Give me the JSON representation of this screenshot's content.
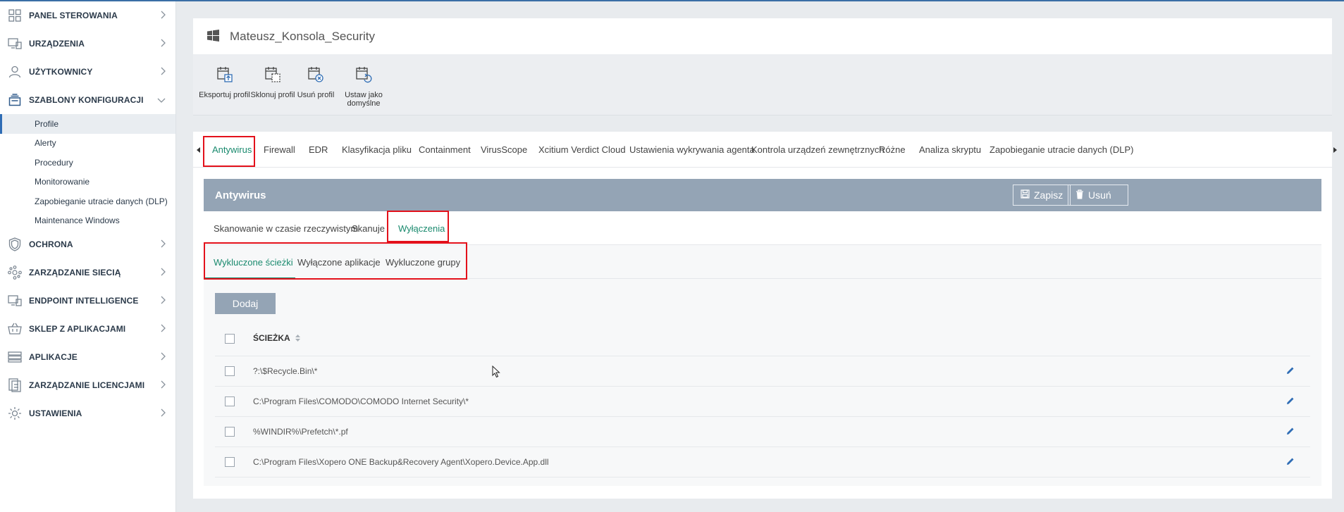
{
  "sidebar": {
    "items": [
      {
        "label": "PANEL STEROWANIA",
        "icon": "dashboard-icon"
      },
      {
        "label": "URZĄDZENIA",
        "icon": "devices-icon"
      },
      {
        "label": "UŻYTKOWNICY",
        "icon": "user-icon"
      },
      {
        "label": "SZABLONY KONFIGURACJI",
        "icon": "templates-icon"
      },
      {
        "label": "OCHRONA",
        "icon": "shield-icon"
      },
      {
        "label": "ZARZĄDZANIE SIECIĄ",
        "icon": "network-icon"
      },
      {
        "label": "ENDPOINT INTELLIGENCE",
        "icon": "endpoint-icon"
      },
      {
        "label": "SKLEP Z APLIKACJAMI",
        "icon": "basket-icon"
      },
      {
        "label": "APLIKACJE",
        "icon": "apps-icon"
      },
      {
        "label": "ZARZĄDZANIE LICENCJAMI",
        "icon": "license-icon"
      },
      {
        "label": "USTAWIENIA",
        "icon": "gear-icon"
      }
    ],
    "subitems": [
      "Profile",
      "Alerty",
      "Procedury",
      "Monitorowanie",
      "Zapobieganie utracie danych (DLP)",
      "Maintenance Windows"
    ]
  },
  "header": {
    "title": "Mateusz_Konsola_Security",
    "icon": "windows-icon"
  },
  "toolbar": {
    "export": "Eksportuj profil",
    "clone": "Sklonuj profil",
    "delete": "Usuń profil",
    "default_line1": "Ustaw jako",
    "default_line2": "domyślne"
  },
  "tabs": [
    "Antywirus",
    "Firewall",
    "EDR",
    "Klasyfikacja pliku",
    "Containment",
    "VirusScope",
    "Xcitium Verdict Cloud",
    "Ustawienia wykrywania agenta",
    "Kontrola urządzeń zewnętrznych",
    "Różne",
    "Analiza skryptu",
    "Zapobieganie utracie danych (DLP)"
  ],
  "panel": {
    "title": "Antywirus",
    "save": "Zapisz",
    "remove": "Usuń",
    "subtabs": [
      "Skanowanie w czasie rzeczywistym",
      "Skanuje",
      "Wyłączenia"
    ],
    "subtabs2": [
      "Wykluczone ścieżki",
      "Wyłączone aplikacje",
      "Wykluczone grupy"
    ],
    "add": "Dodaj",
    "column": "ŚCIEŻKA",
    "rows": [
      "?:\\$Recycle.Bin\\*",
      "C:\\Program Files\\COMODO\\COMODO Internet Security\\*",
      "%WINDIR%\\Prefetch\\*.pf",
      "C:\\Program Files\\Xopero ONE Backup&Recovery Agent\\Xopero.Device.App.dll"
    ]
  },
  "colors": {
    "accent": "#1a8a6e",
    "panel_header": "#94a4b5",
    "highlight": "#e3111b",
    "link": "#2f6db5"
  }
}
